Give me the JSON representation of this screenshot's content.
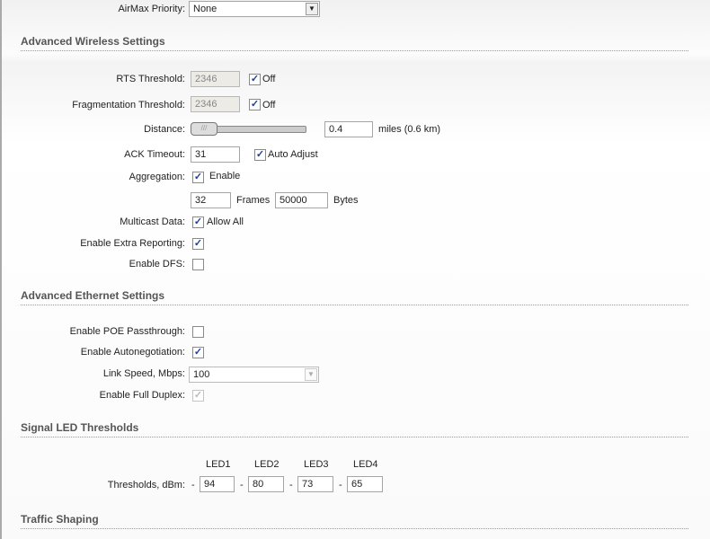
{
  "airmax": {
    "label": "AirMax Priority:",
    "value": "None"
  },
  "wireless": {
    "title": "Advanced Wireless Settings",
    "rts": {
      "label": "RTS Threshold:",
      "value": "2346",
      "off_label": "Off",
      "off_checked": true
    },
    "frag": {
      "label": "Fragmentation Threshold:",
      "value": "2346",
      "off_label": "Off",
      "off_checked": true
    },
    "distance": {
      "label": "Distance:",
      "value": "0.4",
      "unit": "miles (0.6 km)",
      "slider_fraction": 0.0
    },
    "ack": {
      "label": "ACK Timeout:",
      "value": "31",
      "auto_label": "Auto Adjust",
      "auto_checked": true
    },
    "aggregation": {
      "label": "Aggregation:",
      "enable_label": "Enable",
      "checked": true,
      "frames": "32",
      "frames_label": "Frames",
      "bytes": "50000",
      "bytes_label": "Bytes"
    },
    "multicast": {
      "label": "Multicast Data:",
      "allow_label": "Allow All",
      "checked": true
    },
    "extra": {
      "label": "Enable Extra Reporting:",
      "checked": true
    },
    "dfs": {
      "label": "Enable DFS:",
      "checked": false
    }
  },
  "ethernet": {
    "title": "Advanced Ethernet Settings",
    "poe": {
      "label": "Enable POE Passthrough:",
      "checked": false
    },
    "autoneg": {
      "label": "Enable Autonegotiation:",
      "checked": true
    },
    "speed": {
      "label": "Link Speed, Mbps:",
      "value": "100"
    },
    "duplex": {
      "label": "Enable Full Duplex:",
      "checked": true
    }
  },
  "led": {
    "title": "Signal LED Thresholds",
    "label": "Thresholds, dBm:",
    "dash": "-",
    "headers": [
      "LED1",
      "LED2",
      "LED3",
      "LED4"
    ],
    "values": [
      "94",
      "80",
      "73",
      "65"
    ]
  },
  "traffic": {
    "title": "Traffic Shaping"
  }
}
